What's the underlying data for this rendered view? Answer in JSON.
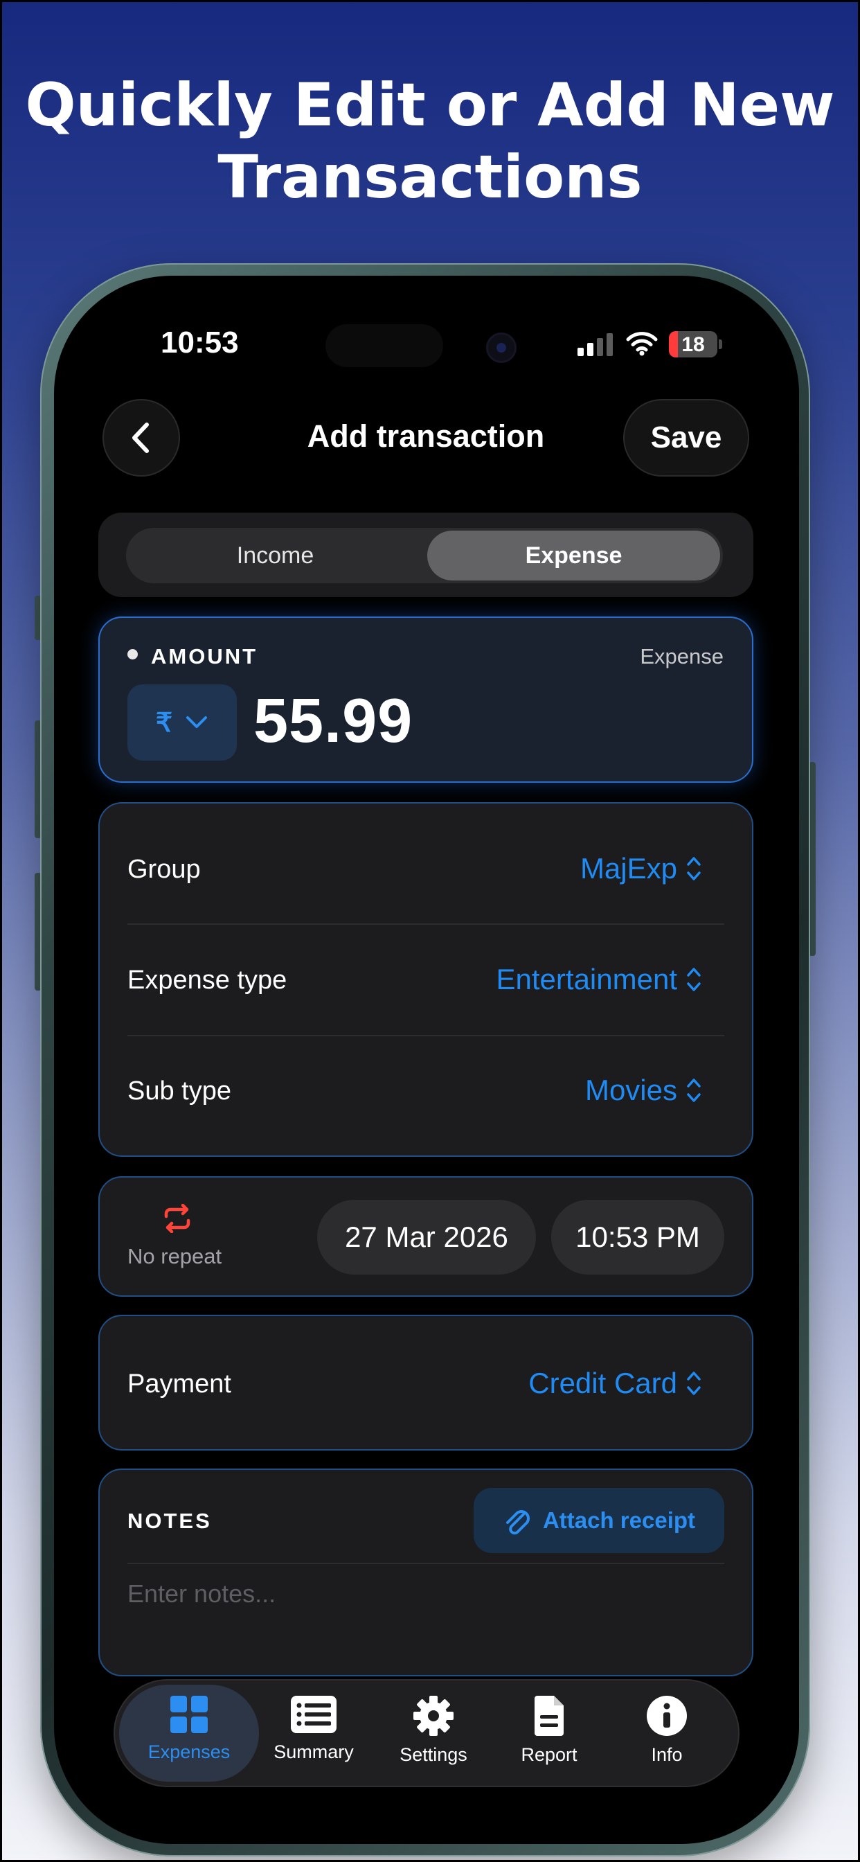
{
  "headline": {
    "line1": "Quickly Edit or Add New",
    "line2": "Transactions"
  },
  "status_bar": {
    "time": "10:53",
    "battery": "18"
  },
  "nav": {
    "title": "Add transaction",
    "save_label": "Save",
    "back_icon": "chevron-left-icon"
  },
  "segmented": {
    "options": [
      "Income",
      "Expense"
    ],
    "selected": "Expense"
  },
  "amount": {
    "label": "AMOUNT",
    "type": "Expense",
    "currency_symbol": "₹",
    "value": "55.99"
  },
  "category": {
    "rows": [
      {
        "label": "Group",
        "value": "MajExp"
      },
      {
        "label": "Expense type",
        "value": "Entertainment"
      },
      {
        "label": "Sub type",
        "value": "Movies"
      }
    ]
  },
  "schedule": {
    "repeat_label": "No repeat",
    "date": "27 Mar 2026",
    "time": "10:53 PM"
  },
  "payment": {
    "label": "Payment",
    "value": "Credit Card"
  },
  "notes": {
    "label": "NOTES",
    "attach_label": "Attach receipt",
    "placeholder": "Enter notes..."
  },
  "tabs": [
    {
      "label": "Expenses",
      "icon": "grid-icon",
      "active": true
    },
    {
      "label": "Summary",
      "icon": "list-icon",
      "active": false
    },
    {
      "label": "Settings",
      "icon": "gear-icon",
      "active": false
    },
    {
      "label": "Report",
      "icon": "document-icon",
      "active": false
    },
    {
      "label": "Info",
      "icon": "info-icon",
      "active": false
    }
  ],
  "colors": {
    "accent": "#1f8bf3",
    "repeat_icon": "#ff453a",
    "background_top": "#17297e",
    "background_bottom": "#f3f4f9"
  }
}
